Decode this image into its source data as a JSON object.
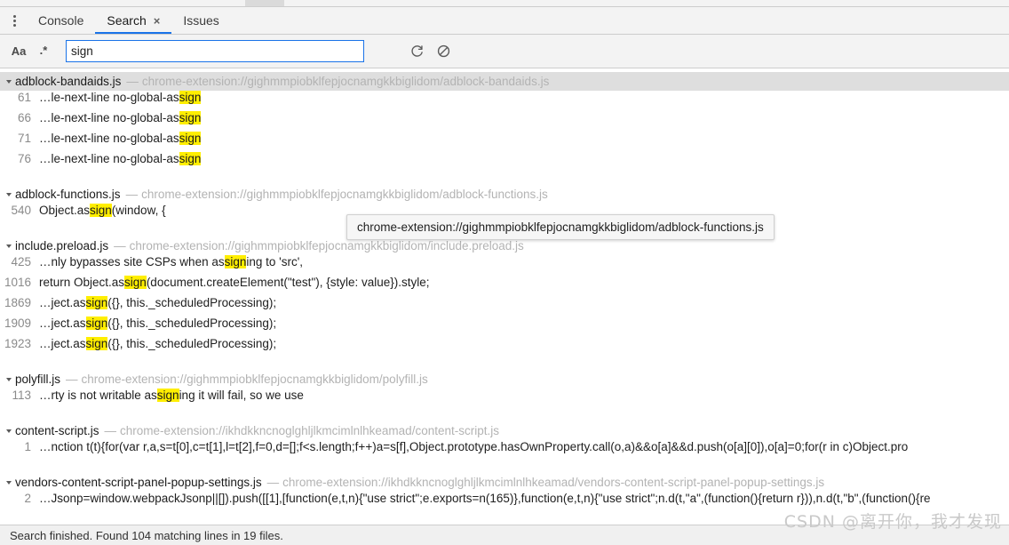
{
  "window": {
    "drag_handle": "panel-drag-handle"
  },
  "tabbar": {
    "more_icon": "more-vertical-icon",
    "tabs": [
      {
        "label": "Console",
        "active": false,
        "closable": false
      },
      {
        "label": "Search",
        "active": true,
        "closable": true,
        "close_glyph": "×"
      },
      {
        "label": "Issues",
        "active": false,
        "closable": false
      }
    ]
  },
  "searchbar": {
    "match_case_label": "Aa",
    "regex_label": ".*",
    "query_value": "sign",
    "query_placeholder": "",
    "refresh_icon": "refresh-icon",
    "clear_icon": "clear-icon"
  },
  "tooltip": {
    "text": "chrome-extension://gighmmpiobklfepjocnamgkkbiglidom/adblock-functions.js"
  },
  "results": {
    "highlight_color": "#ffee00",
    "groups": [
      {
        "file": "adblock-bandaids.js",
        "url": "chrome-extension://gighmmpiobklfepjocnamgkkbiglidom/adblock-bandaids.js",
        "expanded": true,
        "selected": true,
        "matches": [
          {
            "line": "61",
            "pre": "…le-next-line no-global-as",
            "hl": "sign",
            "post": ""
          },
          {
            "line": "66",
            "pre": "…le-next-line no-global-as",
            "hl": "sign",
            "post": ""
          },
          {
            "line": "71",
            "pre": "…le-next-line no-global-as",
            "hl": "sign",
            "post": ""
          },
          {
            "line": "76",
            "pre": "…le-next-line no-global-as",
            "hl": "sign",
            "post": ""
          }
        ]
      },
      {
        "file": "adblock-functions.js",
        "url": "chrome-extension://gighmmpiobklfepjocnamgkkbiglidom/adblock-functions.js",
        "expanded": true,
        "selected": false,
        "matches": [
          {
            "line": "540",
            "pre": "Object.as",
            "hl": "sign",
            "post": "(window, {"
          }
        ]
      },
      {
        "file": "include.preload.js",
        "url": "chrome-extension://gighmmpiobklfepjocnamgkkbiglidom/include.preload.js",
        "expanded": true,
        "selected": false,
        "matches": [
          {
            "line": "425",
            "pre": "…nly bypasses site CSPs when as",
            "hl": "sign",
            "post": "ing to 'src',"
          },
          {
            "line": "1016",
            "pre": "return Object.as",
            "hl": "sign",
            "post": "(document.createElement(\"test\"), {style: value}).style;"
          },
          {
            "line": "1869",
            "pre": "…ject.as",
            "hl": "sign",
            "post": "({}, this._scheduledProcessing);"
          },
          {
            "line": "1909",
            "pre": "…ject.as",
            "hl": "sign",
            "post": "({}, this._scheduledProcessing);"
          },
          {
            "line": "1923",
            "pre": "…ject.as",
            "hl": "sign",
            "post": "({}, this._scheduledProcessing);"
          }
        ]
      },
      {
        "file": "polyfill.js",
        "url": "chrome-extension://gighmmpiobklfepjocnamgkkbiglidom/polyfill.js",
        "expanded": true,
        "selected": false,
        "matches": [
          {
            "line": "113",
            "pre": "…rty is not writable as",
            "hl": "sign",
            "post": "ing it will fail, so we use"
          }
        ]
      },
      {
        "file": "content-script.js",
        "url": "chrome-extension://ikhdkkncnoglghljlkmcimlnlhkeamad/content-script.js",
        "expanded": true,
        "selected": false,
        "matches": [
          {
            "line": "1",
            "pre": "…nction t(t){for(var r,a,s=t[0],c=t[1],l=t[2],f=0,d=[];f<s.length;f++)a=s[f],Object.prototype.hasOwnProperty.call(o,a)&&o[a]&&d.push(o[a][0]),o[a]=0;for(r in c)Object.pro",
            "hl": "",
            "post": ""
          }
        ]
      },
      {
        "file": "vendors-content-script-panel-popup-settings.js",
        "url": "chrome-extension://ikhdkkncnoglghljlkmcimlnlhkeamad/vendors-content-script-panel-popup-settings.js",
        "expanded": true,
        "selected": false,
        "matches": [
          {
            "line": "2",
            "pre": "…Jsonp=window.webpackJsonp||[]).push([[1],[function(e,t,n){\"use strict\";e.exports=n(165)},function(e,t,n){\"use strict\";n.d(t,\"a\",(function(){return r})),n.d(t,\"b\",(function(){re",
            "hl": "",
            "post": ""
          }
        ]
      }
    ]
  },
  "statusbar": {
    "text": "Search finished.  Found 104 matching lines in 19 files."
  },
  "watermark": {
    "text": "CSDN @离开你，我才发现"
  }
}
